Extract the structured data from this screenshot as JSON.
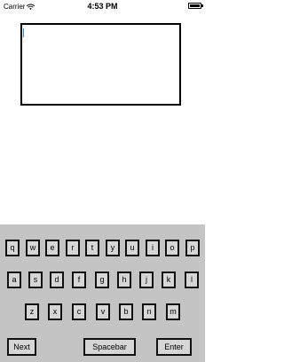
{
  "status_bar": {
    "carrier": "Carrier",
    "time": "4:53 PM",
    "icons": [
      "wifi-icon",
      "battery-icon"
    ]
  },
  "text_area": {
    "value": ""
  },
  "keyboard": {
    "rows": [
      [
        "q",
        "w",
        "e",
        "r",
        "t",
        "y",
        "u",
        "i",
        "o",
        "p"
      ],
      [
        "a",
        "s",
        "d",
        "f",
        "g",
        "h",
        "j",
        "k",
        "l"
      ],
      [
        "z",
        "x",
        "c",
        "v",
        "b",
        "n",
        "m"
      ]
    ],
    "bottom": {
      "next": "Next",
      "spacebar": "Spacebar",
      "enter": "Enter"
    }
  }
}
